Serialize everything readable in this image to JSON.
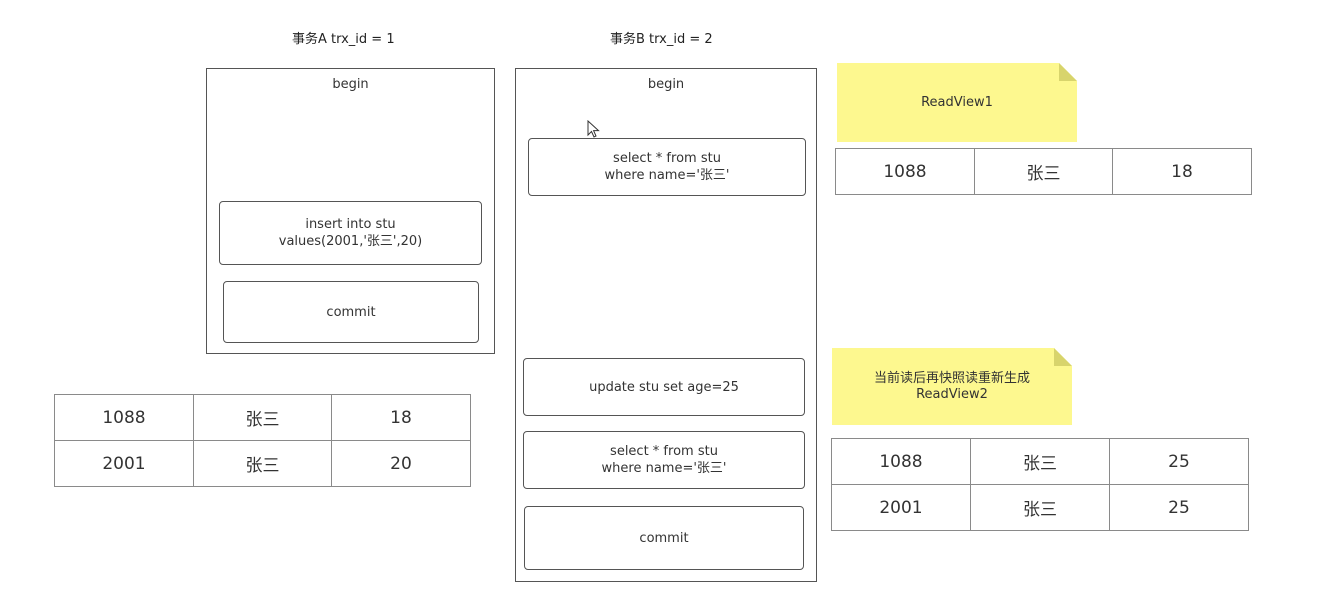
{
  "txA": {
    "title": "事务A trx_id = 1",
    "begin": "begin",
    "insert": "insert into stu\nvalues(2001,'张三',20)",
    "commit": "commit"
  },
  "txB": {
    "title": "事务B trx_id = 2",
    "begin": "begin",
    "select1": "select * from stu\nwhere name='张三'",
    "update": "update stu set age=25",
    "select2": "select * from stu\nwhere name='张三'",
    "commit": "commit"
  },
  "tableA": {
    "rows": [
      [
        "1088",
        "张三",
        "18"
      ],
      [
        "2001",
        "张三",
        "20"
      ]
    ]
  },
  "readview1": {
    "label": "ReadView1",
    "rows": [
      [
        "1088",
        "张三",
        "18"
      ]
    ]
  },
  "readview2": {
    "label": "当前读后再快照读重新生成\nReadView2",
    "rows": [
      [
        "1088",
        "张三",
        "25"
      ],
      [
        "2001",
        "张三",
        "25"
      ]
    ]
  },
  "colors": {
    "note": "#fdf88f",
    "border": "#555555",
    "grid": "#8a8a8a"
  }
}
